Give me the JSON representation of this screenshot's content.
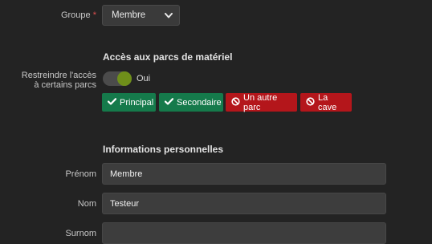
{
  "groupe": {
    "label": "Groupe",
    "required_mark": "*",
    "selected": "Membre",
    "icon": "chevron-down-icon"
  },
  "parcs": {
    "section_title": "Accès aux parcs de matériel",
    "restrict_label_line1": "Restreindre l'accès",
    "restrict_label_line2": "à certains parcs",
    "toggle_state": "Oui",
    "toggle_on": true,
    "buttons": [
      {
        "label": "Principal",
        "icon": "check-icon",
        "state": "selected",
        "color": "#157a4b"
      },
      {
        "label": "Secondaire",
        "icon": "check-icon",
        "state": "selected",
        "color": "#157a4b"
      },
      {
        "label": "Un autre parc",
        "icon": "ban-icon",
        "state": "excluded",
        "color": "#b4161b"
      },
      {
        "label": "La cave",
        "icon": "ban-icon",
        "state": "excluded",
        "color": "#b4161b"
      }
    ]
  },
  "personal": {
    "section_title": "Informations personnelles",
    "prenom_label": "Prénom",
    "prenom_value": "Membre",
    "nom_label": "Nom",
    "nom_value": "Testeur",
    "surnom_label": "Surnom",
    "surnom_value": ""
  }
}
